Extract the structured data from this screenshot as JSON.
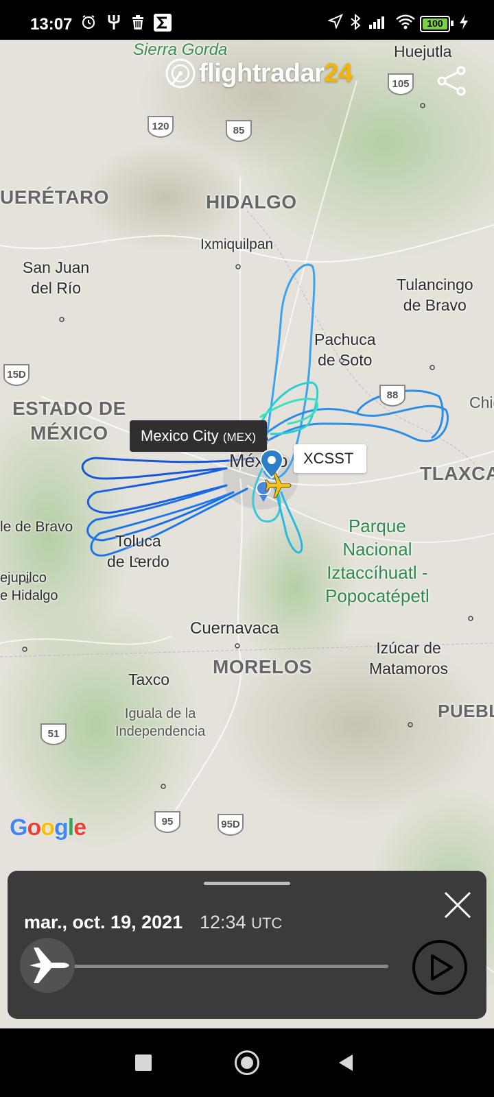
{
  "status_bar": {
    "time": "13:07",
    "battery": "100",
    "icons_left": [
      "alarm-icon",
      "fork-icon",
      "trash-icon",
      "sigma-icon"
    ],
    "icons_right": [
      "location-icon",
      "bluetooth-icon",
      "signal-icon",
      "wifi-icon",
      "battery-icon",
      "charging-icon"
    ]
  },
  "app": {
    "brand_main": "flightradar",
    "brand_num": "24"
  },
  "map": {
    "places": {
      "sierra_gorda": "Sierra Gorda",
      "huejutla": "Huejutla",
      "queretaro": "UERÉTARO",
      "hidalgo": "HIDALGO",
      "ixmiquilpan": "Ixmiquilpan",
      "san_juan": "San Juan\ndel Río",
      "tulancingo": "Tulancingo\nde Bravo",
      "pachuca": "Pachuca\nde Soto",
      "chig": "Chig",
      "estado": "ESTADO DE\nMÉXICO",
      "de_mex": "de\nMéxico",
      "tlaxca": "TLAXCA",
      "bravo": "le de Bravo",
      "toluca": "Toluca\nde Lerdo",
      "parque": "Parque\nNacional\nIztaccíhuatl -\nPopocatépetl",
      "tejupilco": "ejupilco\ne Hidalgo",
      "cuernavaca": "Cuernavaca",
      "izucar": "Izúcar de\nMatamoros",
      "morelos": "MORELOS",
      "taxco": "Taxco",
      "iguala": "Iguala de la\nIndependencia",
      "puebl": "PUEBL"
    },
    "highways": [
      "120",
      "85",
      "105",
      "15D",
      "88",
      "51",
      "95",
      "95D"
    ],
    "airport_tooltip": "Mexico City",
    "airport_code": "(MEX)",
    "callsign": "XCSST",
    "attribution": "Google"
  },
  "playback": {
    "date": "mar., oct. 19, 2021",
    "time": "12:34",
    "tz": "UTC",
    "progress": 0.0
  },
  "nav_bar": {
    "buttons": [
      "recents-button",
      "home-button",
      "back-button"
    ]
  }
}
